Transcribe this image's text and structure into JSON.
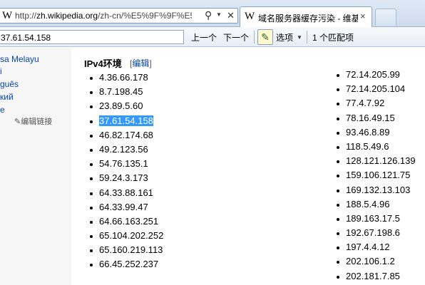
{
  "browser": {
    "address": {
      "logo": "W",
      "url_prefix": "http://",
      "url_host": "zh.wikipedia.org",
      "url_rest": "/zh-cn/%E5%9F%9F%E5%9",
      "icons": [
        "search-icon",
        "dropdown-icon",
        "close-icon"
      ]
    },
    "tab": {
      "logo": "W",
      "title": "域名服务器缓存污染 - 维基...",
      "close": "×"
    }
  },
  "findbar": {
    "query": "37.61.54.158",
    "prev_label": "上一个",
    "next_label": "下一个",
    "options_label": "选项",
    "match_count": "1 个匹配项"
  },
  "sidebar": {
    "languages": [
      "sa Melayu",
      "i",
      "guês",
      "кий",
      "e"
    ],
    "edit_links": "✎编辑链接"
  },
  "content": {
    "heading": "IPv4环境",
    "edit_link": "编辑",
    "highlight_color": "#3399ff",
    "col1": [
      "4.36.66.178",
      "8.7.198.45",
      "23.89.5.60",
      "37.61.54.158",
      "46.82.174.68",
      "49.2.123.56",
      "54.76.135.1",
      "59.24.3.173",
      "64.33.88.161",
      "64.33.99.47",
      "64.66.163.251",
      "65.104.202.252",
      "65.160.219.113",
      "66.45.252.237"
    ],
    "col2": [
      "72.14.205.99",
      "72.14.205.104",
      "77.4.7.92",
      "78.16.49.15",
      "93.46.8.89",
      "118.5.49.6",
      "128.121.126.139",
      "159.106.121.75",
      "169.132.13.103",
      "188.5.4.96",
      "189.163.17.5",
      "192.67.198.6",
      "197.4.4.12",
      "202.106.1.2",
      "202.181.7.85"
    ]
  }
}
